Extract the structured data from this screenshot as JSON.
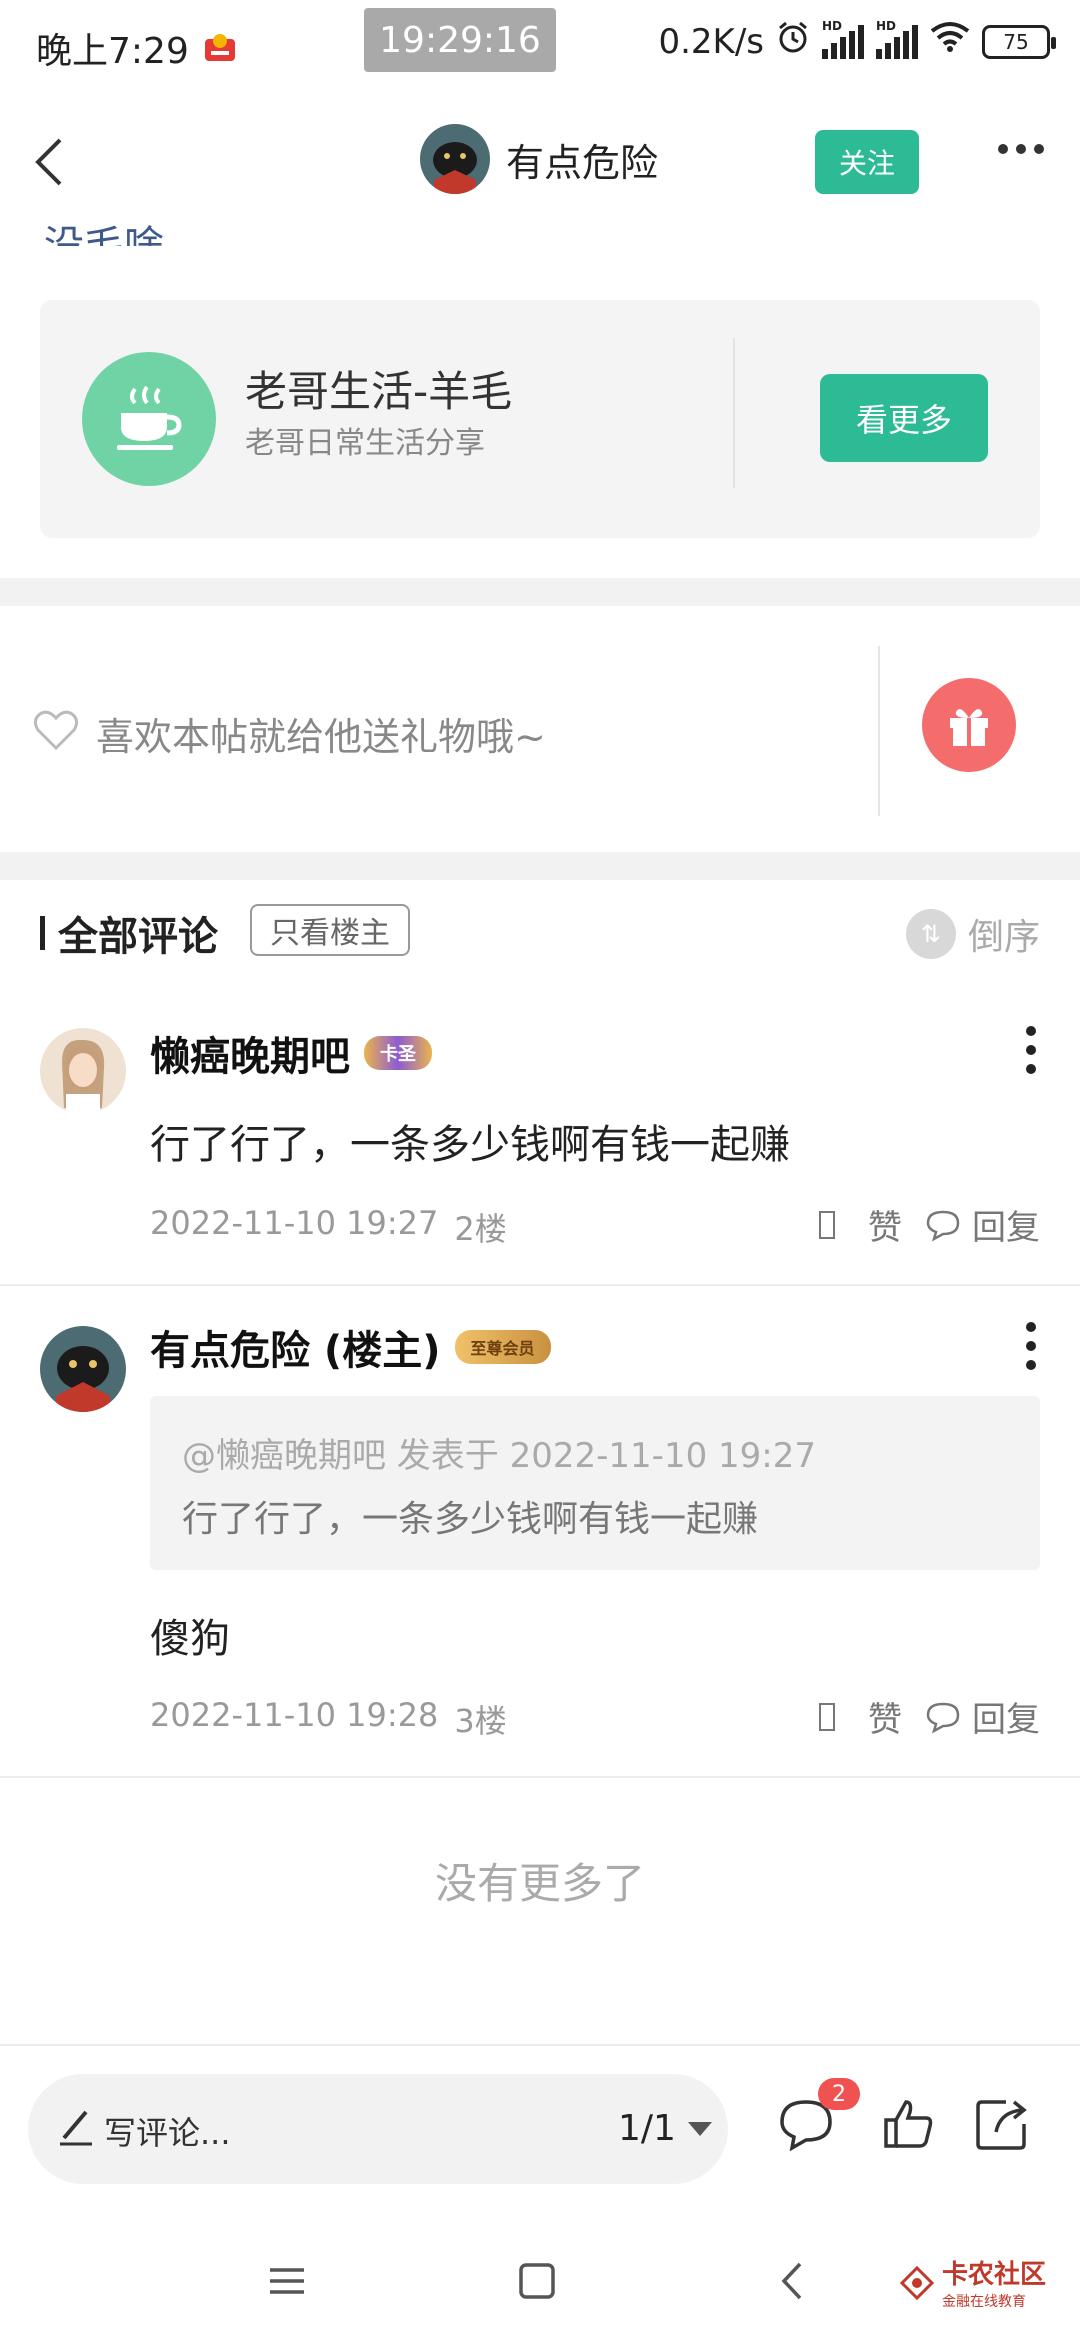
{
  "status_bar": {
    "time_label": "晚上7:29",
    "clock": "19:29:16",
    "net_speed": "0.2K/s",
    "battery": "75",
    "hd1": "HD",
    "hd2": "HD"
  },
  "header": {
    "author_name": "有点危险",
    "follow_label": "关注"
  },
  "cut_text": "没毛啥",
  "group_card": {
    "name": "老哥生活-羊毛",
    "description": "老哥日常生活分享",
    "button_label": "看更多"
  },
  "gift": {
    "prompt": "喜欢本帖就给他送礼物哦~"
  },
  "comments_header": {
    "title": "全部评论",
    "only_op_label": "只看楼主",
    "sort_label": "倒序"
  },
  "comments": [
    {
      "author": "懒癌晚期吧",
      "badge": "卡圣",
      "body": "行了行了，一条多少钱啊有钱一起赚",
      "date": "2022-11-10 19:27",
      "floor": "2楼",
      "like_label": "赞",
      "reply_label": "回复"
    },
    {
      "author": "有点危险 (楼主)",
      "badge": "至尊会员",
      "quote_head": "@懒癌晚期吧 发表于 2022-11-10 19:27",
      "quote_text": "行了行了，一条多少钱啊有钱一起赚",
      "body": "傻狗",
      "date": "2022-11-10 19:28",
      "floor": "3楼",
      "like_label": "赞",
      "reply_label": "回复"
    }
  ],
  "no_more_text": "没有更多了",
  "bottom_bar": {
    "write_placeholder": "写评论...",
    "page_indicator": "1/1",
    "comment_count": "2"
  },
  "watermark": {
    "title": "卡农社区",
    "subtitle": "金融在线教育"
  },
  "colors": {
    "accent_green": "#2dbb96",
    "gift_red": "#f56c6c",
    "badge_red": "#f05252"
  }
}
